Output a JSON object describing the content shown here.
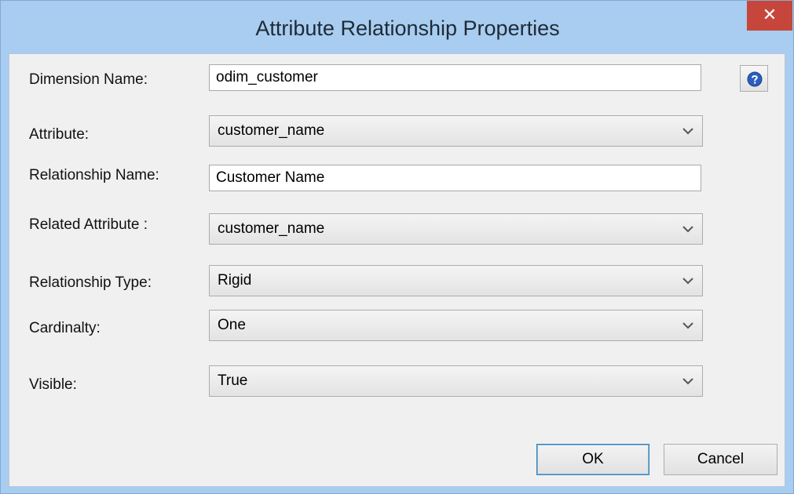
{
  "window": {
    "title": "Attribute Relationship Properties",
    "close_glyph": "✕"
  },
  "form": {
    "dimension_name": {
      "label": "Dimension Name:",
      "value": "odim_customer"
    },
    "attribute": {
      "label": "Attribute:",
      "value": "customer_name"
    },
    "relationship_name": {
      "label": "Relationship Name:",
      "value": "Customer Name"
    },
    "related_attribute": {
      "label": "Related Attribute :",
      "value": "customer_name"
    },
    "relationship_type": {
      "label": "Relationship Type:",
      "value": "Rigid"
    },
    "cardinality": {
      "label": "Cardinalty:",
      "value": "One"
    },
    "visible": {
      "label": "Visible:",
      "value": "True"
    }
  },
  "buttons": {
    "ok_label": "OK",
    "cancel_label": "Cancel",
    "help_icon": "help-icon"
  },
  "colors": {
    "title_bar": "#a8cdf0",
    "close_button": "#c7463c",
    "dialog_background": "#f0f0f0",
    "help_icon_blue": "#2a5fbf"
  }
}
